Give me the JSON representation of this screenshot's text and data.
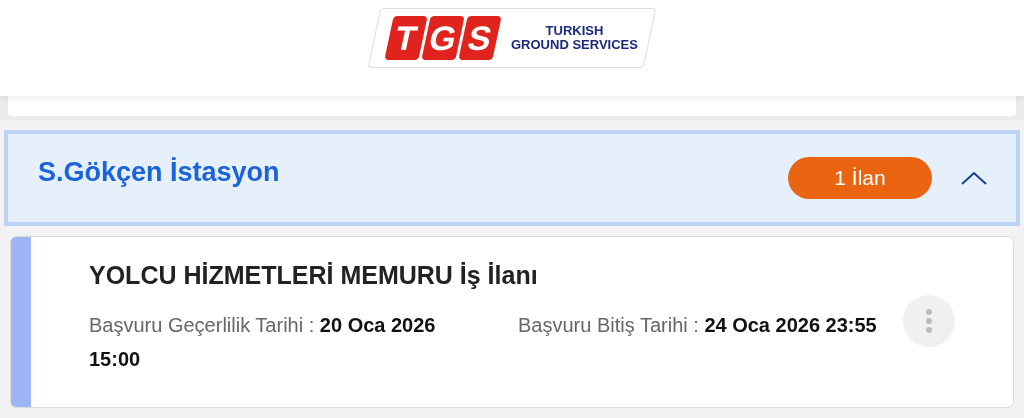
{
  "logo": {
    "letters": [
      "T",
      "G",
      "S"
    ],
    "lines": [
      "TURKISH",
      "GROUND SERVICES"
    ]
  },
  "station": {
    "name": "S.Gökçen İstasyon",
    "count": "1 İlan",
    "expanded": true
  },
  "listings": [
    {
      "title": "YOLCU HİZMETLERİ MEMURU İş İlanı",
      "dates": [
        "Başvuru Geçerlilik Tarihi : **20 Oca 2026 15:00**",
        "Başvuru Bitiş Tarihi : **24 Oca 2026 23:55**"
      ]
    }
  ]
}
